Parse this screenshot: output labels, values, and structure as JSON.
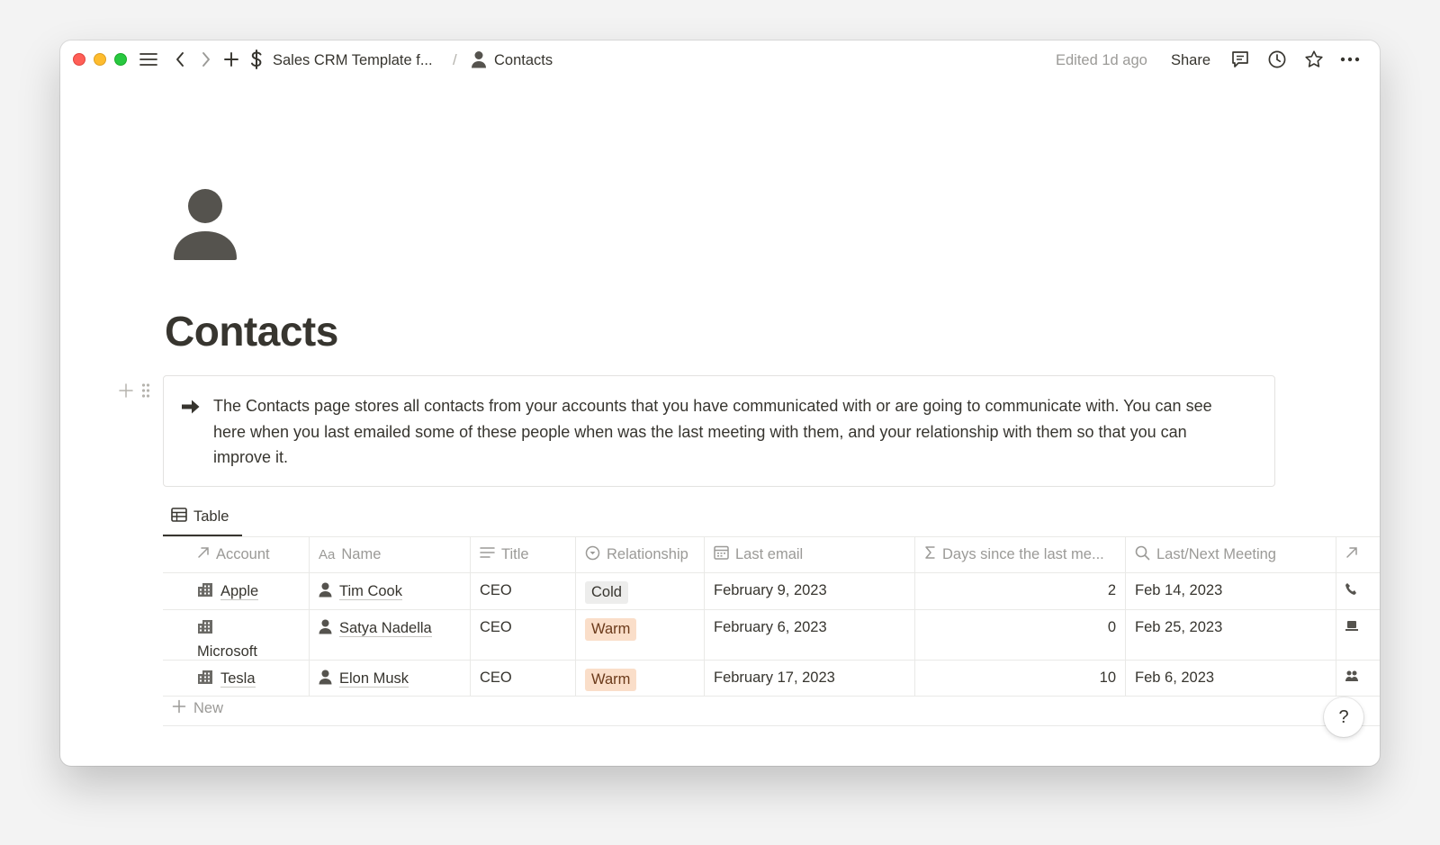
{
  "window": {
    "breadcrumb": {
      "parent_label": "Sales CRM Template f...",
      "separator": "/",
      "current_label": "Contacts"
    },
    "edited_text": "Edited 1d ago",
    "share_label": "Share"
  },
  "page": {
    "title": "Contacts",
    "callout_text": "The Contacts page stores all contacts from your accounts that you have communicated with or are going to communicate with. You can see here when you last emailed some of these people when was the last meeting with them, and your relationship with them so that you can improve it."
  },
  "view": {
    "tab_label": "Table"
  },
  "table": {
    "columns": [
      "Account",
      "Name",
      "Title",
      "Relationship",
      "Last email",
      "Days since the last me...",
      "Last/Next Meeting"
    ],
    "rows": [
      {
        "account": "Apple",
        "name": "Tim Cook",
        "title": "CEO",
        "relationship": "Cold",
        "last_email": "February 9, 2023",
        "days": "2",
        "meeting": "Feb 14, 2023"
      },
      {
        "account": "Microsoft",
        "name": "Satya Nadella",
        "title": "CEO",
        "relationship": "Warm",
        "last_email": "February 6, 2023",
        "days": "0",
        "meeting": "Feb 25, 2023"
      },
      {
        "account": "Tesla",
        "name": "Elon Musk",
        "title": "CEO",
        "relationship": "Warm",
        "last_email": "February 17, 2023",
        "days": "10",
        "meeting": "Feb 6, 2023"
      }
    ],
    "new_label": "New"
  },
  "help_label": "?",
  "colors": {
    "cold_pill": "#ededec",
    "warm_pill": "#fadec9",
    "text": "#37352f",
    "muted": "#9b9a97"
  },
  "icons": [
    "menu-icon",
    "back-arrow-icon",
    "forward-arrow-icon",
    "plus-icon",
    "dollar-icon",
    "person-icon",
    "comment-icon",
    "clock-icon",
    "star-icon",
    "more-icon",
    "arrow-right-icon",
    "table-icon",
    "building-icon"
  ]
}
